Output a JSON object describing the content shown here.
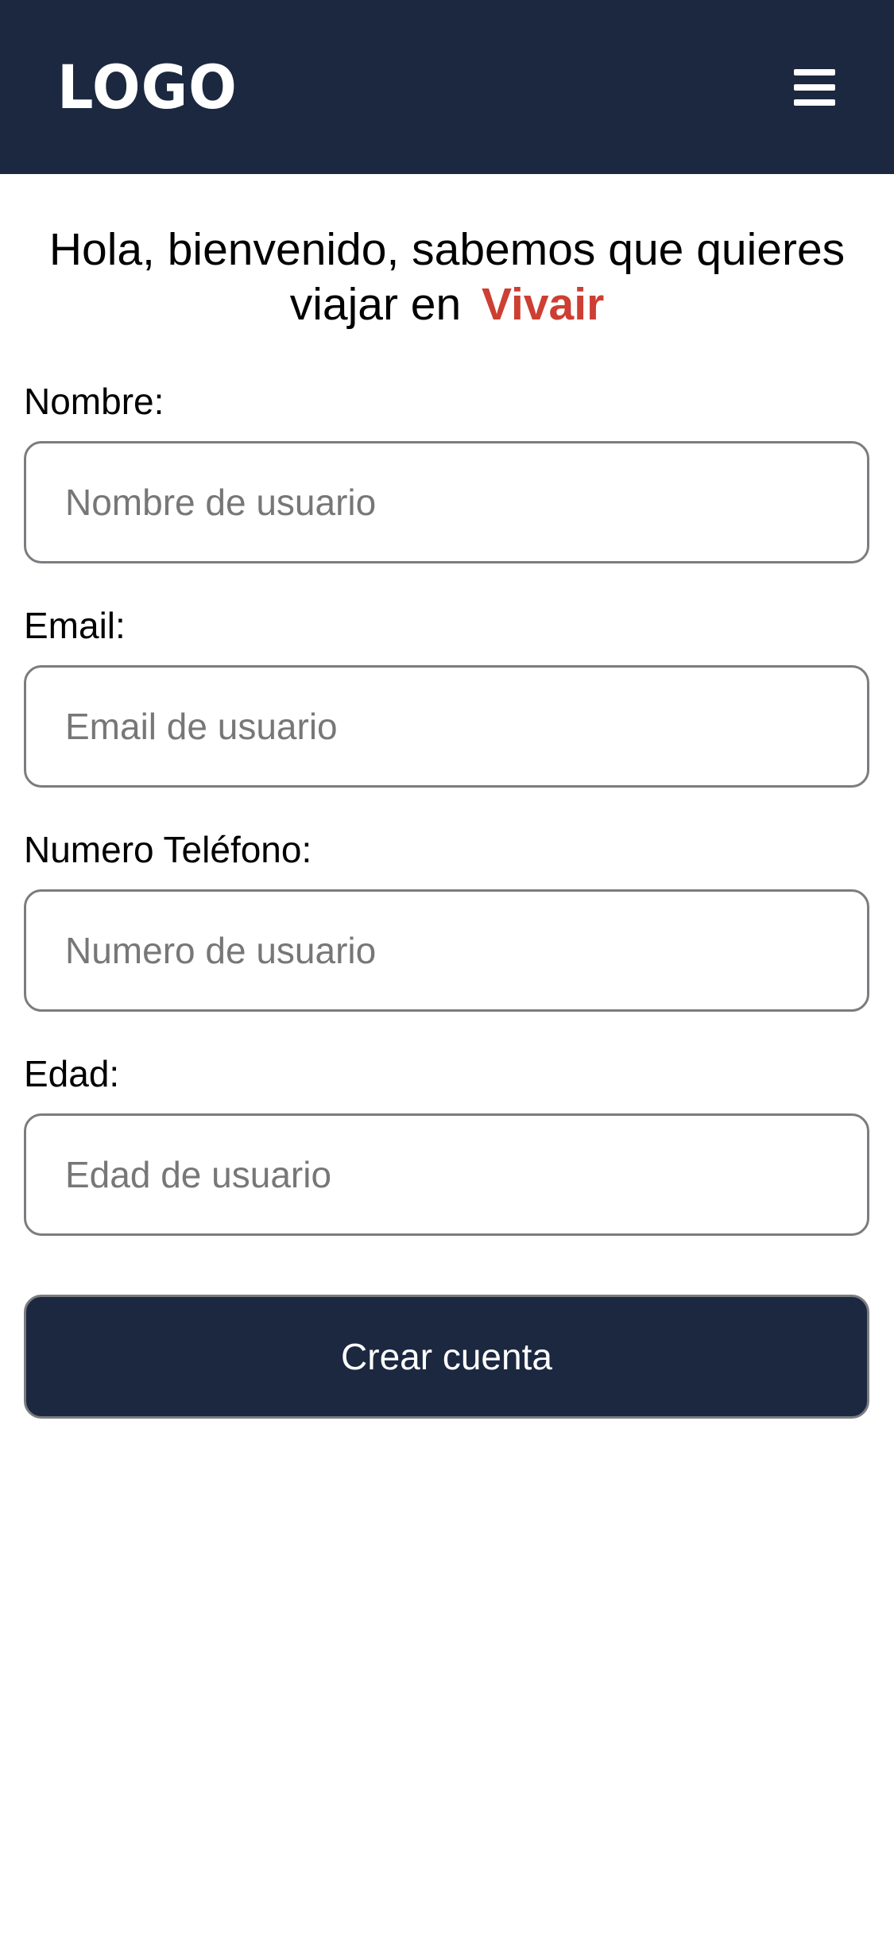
{
  "header": {
    "logo_text": "LOGO",
    "menu_icon": "hamburger-menu-icon",
    "background_color": "#1b2840"
  },
  "welcome": {
    "text": "Hola, bienvenido, sabemos que quieres viajar en",
    "brand": "Vivair",
    "brand_color": "#cc3f32"
  },
  "form": {
    "fields": [
      {
        "label": "Nombre:",
        "placeholder": "Nombre de usuario",
        "value": ""
      },
      {
        "label": "Email:",
        "placeholder": "Email de usuario",
        "value": ""
      },
      {
        "label": "Numero Teléfono:",
        "placeholder": "Numero de usuario",
        "value": ""
      },
      {
        "label": "Edad:",
        "placeholder": "Edad de usuario",
        "value": ""
      }
    ],
    "submit_label": "Crear cuenta"
  }
}
